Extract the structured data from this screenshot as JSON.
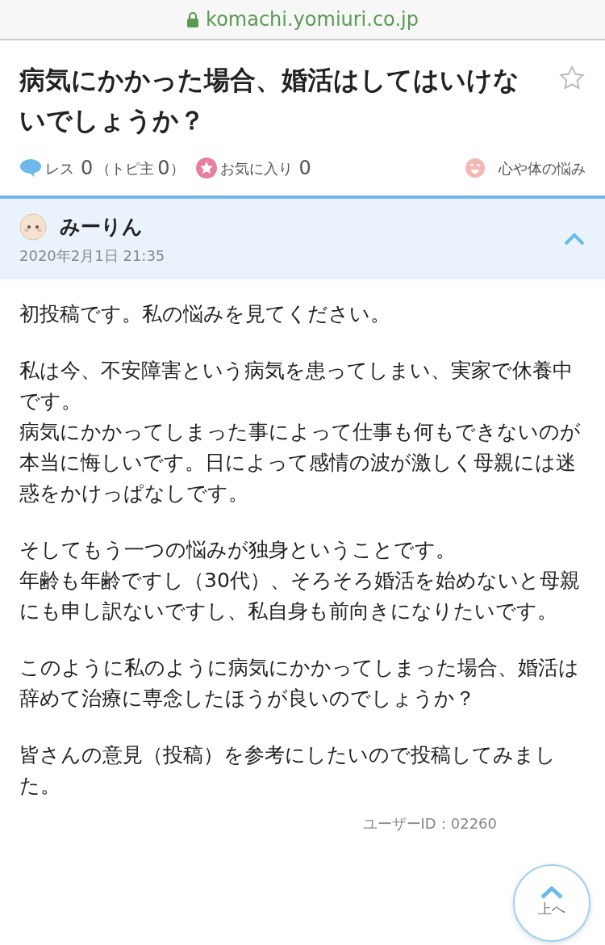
{
  "address_bar": {
    "url": "komachi.yomiuri.co.jp"
  },
  "topic": {
    "title": "病気にかかった場合、婚活はしてはいけないでしょうか？",
    "favorited": false
  },
  "meta": {
    "res_label": "レス",
    "res_count": "0",
    "owner_open": "（トピ主",
    "owner_count": "0",
    "owner_close": "）",
    "fav_label": "お気に入り",
    "fav_count": "0",
    "category": "心や体の悩み"
  },
  "post": {
    "author": "みーりん",
    "date": "2020年2月1日 21:35",
    "expanded": true,
    "paragraphs": [
      {
        "lines": [
          "初投稿です。私の悩みを見てください。"
        ]
      },
      {
        "lines": [
          "私は今、不安障害という病気を患ってしまい、実家で休養中です。",
          "病気にかかってしまった事によって仕事も何もできないのが本当に悔しいです。日によって感情の波が激しく母親には迷惑をかけっぱなしです。"
        ]
      },
      {
        "lines": [
          "そしてもう一つの悩みが独身ということです。",
          "年齢も年齢ですし（30代）、そろそろ婚活を始めないと母親にも申し訳ないですし、私自身も前向きになりたいです。"
        ]
      },
      {
        "lines": [
          "このように私のように病気にかかってしまった場合、婚活は辞めて治療に専念したほうが良いのでしょうか？"
        ]
      },
      {
        "lines": [
          "皆さんの意見（投稿）を参考にしたいので投稿してみました。"
        ]
      }
    ],
    "user_id": "ユーザーID：02260"
  },
  "back_to_top": {
    "label": "上へ"
  }
}
